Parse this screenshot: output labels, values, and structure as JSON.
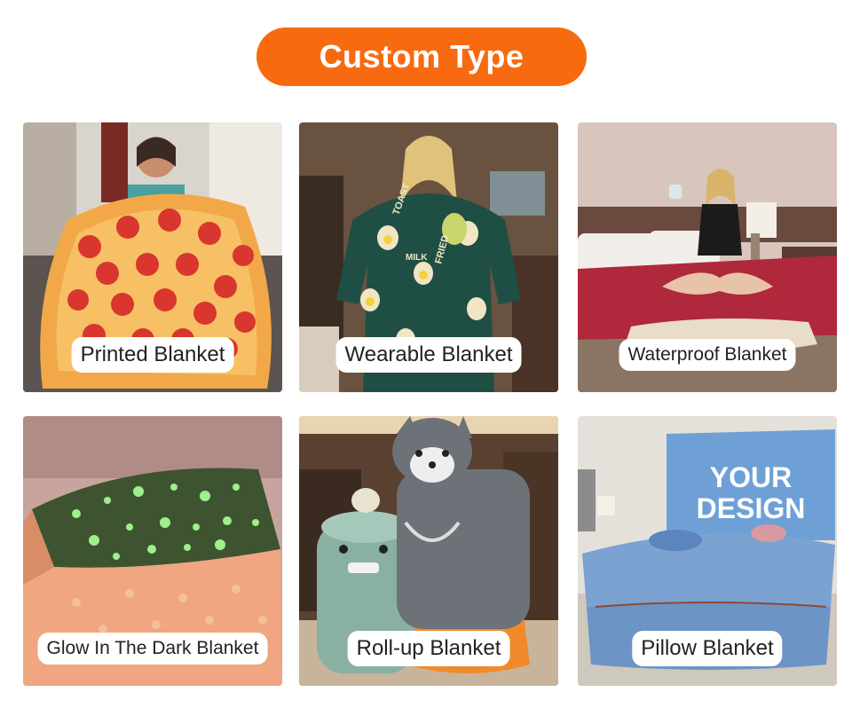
{
  "header": {
    "title": "Custom Type"
  },
  "cards": [
    {
      "label": "Printed Blanket",
      "image": "woman-holding-pizza-blanket"
    },
    {
      "label": "Wearable Blanket",
      "image": "woman-in-food-print-hoodie-blanket",
      "print_text": [
        "TOAST",
        "MILK",
        "FRIED"
      ]
    },
    {
      "label": "Waterproof Blanket",
      "image": "woman-on-red-bed-pouring-water"
    },
    {
      "label": "Glow In The Dark Blanket",
      "image": "glowing-star-blanket"
    },
    {
      "label": "Roll-up Blanket",
      "image": "animal-roll-up-blankets"
    },
    {
      "label": "Pillow Blanket",
      "image": "blue-pillow-blanket",
      "pillow_text": [
        "YOUR",
        "DESIGN"
      ]
    }
  ],
  "colors": {
    "accent": "#f86a10",
    "label_bg": "#ffffff",
    "label_text": "#222222"
  }
}
